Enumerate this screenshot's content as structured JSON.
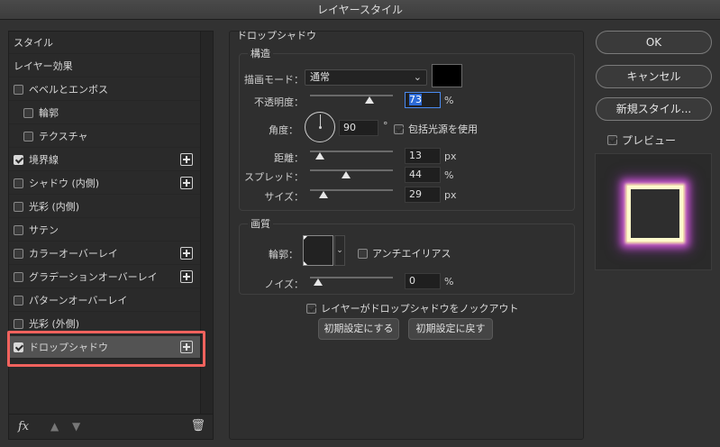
{
  "window": {
    "title": "レイヤースタイル"
  },
  "left_list": {
    "items": [
      {
        "label": "スタイル",
        "checkbox": false,
        "checked": false,
        "plus": false
      },
      {
        "label": "レイヤー効果",
        "checkbox": false,
        "checked": false,
        "plus": false
      },
      {
        "label": "ベベルとエンボス",
        "checkbox": true,
        "checked": false,
        "plus": false
      },
      {
        "label": "輪郭",
        "checkbox": true,
        "checked": false,
        "plus": false
      },
      {
        "label": "テクスチャ",
        "checkbox": true,
        "checked": false,
        "plus": false
      },
      {
        "label": "境界線",
        "checkbox": true,
        "checked": true,
        "plus": true
      },
      {
        "label": "シャドウ (内側)",
        "checkbox": true,
        "checked": false,
        "plus": true
      },
      {
        "label": "光彩 (内側)",
        "checkbox": true,
        "checked": false,
        "plus": false
      },
      {
        "label": "サテン",
        "checkbox": true,
        "checked": false,
        "plus": false
      },
      {
        "label": "カラーオーバーレイ",
        "checkbox": true,
        "checked": false,
        "plus": true
      },
      {
        "label": "グラデーションオーバーレイ",
        "checkbox": true,
        "checked": false,
        "plus": true
      },
      {
        "label": "パターンオーバーレイ",
        "checkbox": true,
        "checked": false,
        "plus": false
      },
      {
        "label": "光彩 (外側)",
        "checkbox": true,
        "checked": false,
        "plus": false
      },
      {
        "label": "ドロップシャドウ",
        "checkbox": true,
        "checked": true,
        "plus": true
      }
    ],
    "selected": "ドロップシャドウ",
    "fx_label": "fx"
  },
  "drop_shadow": {
    "title": "ドロップシャドウ",
    "structure": {
      "title": "構造",
      "blend_mode_label": "描画モード：",
      "blend_mode_value": "通常",
      "shadow_color": "#000000",
      "opacity_label": "不透明度：",
      "opacity_value": "73",
      "opacity_unit": "%",
      "angle_label": "角度：",
      "angle_value": "90",
      "angle_unit": "°",
      "global_light_label": "包括光源を使用",
      "global_light_checked": true,
      "distance_label": "距離：",
      "distance_value": "13",
      "distance_unit": "px",
      "spread_label": "スプレッド：",
      "spread_value": "44",
      "spread_unit": "%",
      "size_label": "サイズ：",
      "size_value": "29",
      "size_unit": "px"
    },
    "quality": {
      "title": "画質",
      "contour_label": "輪郭：",
      "antialias_label": "アンチエイリアス",
      "antialias_checked": false,
      "noise_label": "ノイズ：",
      "noise_value": "0",
      "noise_unit": "%"
    },
    "knockout_label": "レイヤーがドロップシャドウをノックアウト",
    "knockout_checked": true,
    "make_default_label": "初期設定にする",
    "reset_default_label": "初期設定に戻す"
  },
  "right_panel": {
    "ok_label": "OK",
    "cancel_label": "キャンセル",
    "new_style_label": "新規スタイル...",
    "preview_label": "プレビュー",
    "preview_checked": true
  }
}
